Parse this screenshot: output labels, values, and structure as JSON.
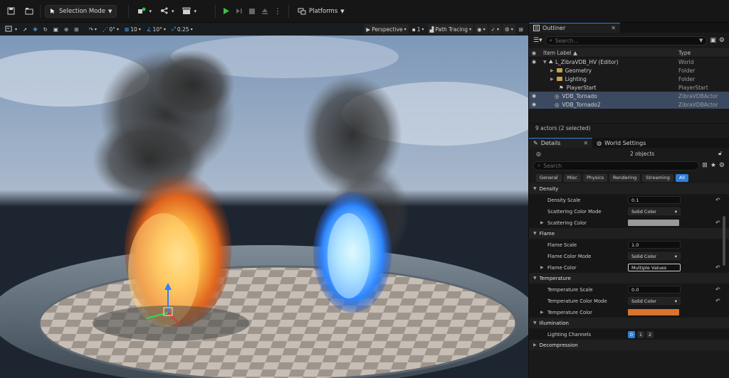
{
  "toolbar": {
    "selection_mode": "Selection Mode",
    "platforms": "Platforms"
  },
  "viewport": {
    "rotation_snap": "0°",
    "grid_snap": "10",
    "angle_snap": "10°",
    "scale_snap": "0.25",
    "perspective": "Perspective",
    "layout_count": "1",
    "view_mode": "Path Tracing"
  },
  "outliner": {
    "tab_label": "Outliner",
    "search_placeholder": "Search...",
    "col_label": "Item Label ▲",
    "col_type": "Type",
    "rows": [
      {
        "label": "L_ZibraVDB_HV (Editor)",
        "type": "World"
      },
      {
        "label": "Geometry",
        "type": "Folder"
      },
      {
        "label": "Lighting",
        "type": "Folder"
      },
      {
        "label": "PlayerStart",
        "type": "PlayerStart"
      },
      {
        "label": "VDB_Tornado",
        "type": "ZibraVDBActor"
      },
      {
        "label": "VDB_Tornado2",
        "type": "ZibraVDBActor"
      }
    ],
    "actor_count": "9 actors (2 selected)"
  },
  "details": {
    "tab_details": "Details",
    "tab_world": "World Settings",
    "objects": "2 objects",
    "search_placeholder": "Search",
    "filters": [
      "General",
      "Misc",
      "Physics",
      "Rendering",
      "Streaming",
      "All"
    ],
    "sections": {
      "density": "Density",
      "flame": "Flame",
      "temperature": "Temperature",
      "illumination": "Illumination",
      "decompression": "Decompression"
    },
    "props": {
      "density_scale_label": "Density Scale",
      "density_scale_value": "0.1",
      "scattering_mode_label": "Scattering Color Mode",
      "scattering_mode_value": "Solid Color",
      "scattering_color_label": "Scattering Color",
      "flame_scale_label": "Flame Scale",
      "flame_scale_value": "1.0",
      "flame_mode_label": "Flame Color Mode",
      "flame_mode_value": "Solid Color",
      "flame_color_label": "Flame Color",
      "flame_color_value": "Multiple Values",
      "temp_scale_label": "Temperature Scale",
      "temp_scale_value": "0.0",
      "temp_mode_label": "Temperature Color Mode",
      "temp_mode_value": "Solid Color",
      "temp_color_label": "Temperature Color",
      "lighting_channels_label": "Lighting Channels",
      "channels": [
        "0",
        "1",
        "2"
      ]
    },
    "colors": {
      "scattering": "#9a9a9a",
      "temperature": "#d9732e"
    }
  }
}
